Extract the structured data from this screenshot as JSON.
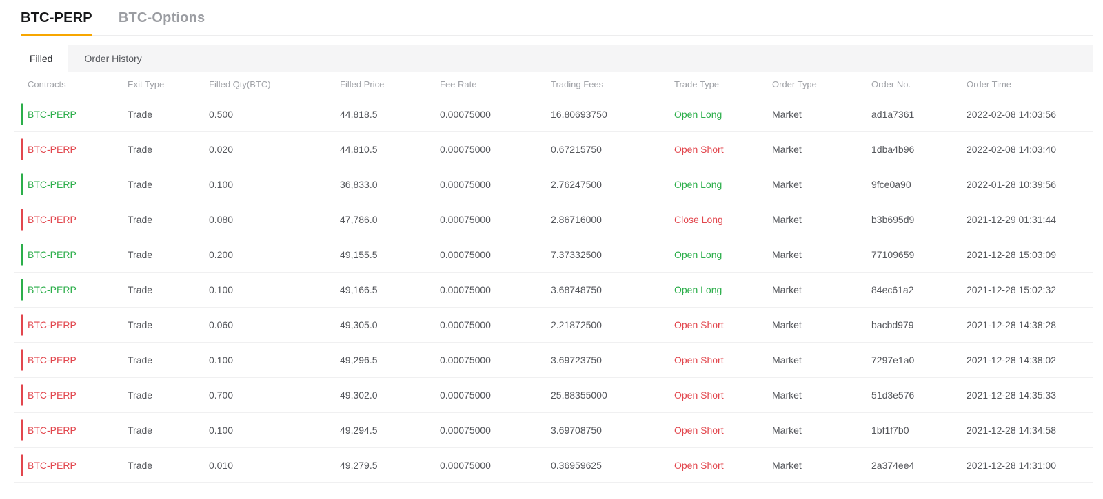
{
  "market_tabs": {
    "items": [
      {
        "label": "BTC-PERP",
        "active": true
      },
      {
        "label": "BTC-Options",
        "active": false
      }
    ]
  },
  "view_tabs": {
    "items": [
      {
        "label": "Filled",
        "active": true
      },
      {
        "label": "Order History",
        "active": false
      }
    ]
  },
  "table": {
    "columns": [
      "Contracts",
      "Exit Type",
      "Filled Qty(BTC)",
      "Filled Price",
      "Fee Rate",
      "Trading Fees",
      "Trade Type",
      "Order Type",
      "Order No.",
      "Order Time"
    ],
    "rows": [
      {
        "color": "green",
        "contracts": "BTC-PERP",
        "exit_type": "Trade",
        "filled_qty": "0.500",
        "filled_price": "44,818.5",
        "fee_rate": "0.00075000",
        "trading_fees": "16.80693750",
        "trade_type": "Open Long",
        "order_type": "Market",
        "order_no": "ad1a7361",
        "order_time": "2022-02-08 14:03:56"
      },
      {
        "color": "red",
        "contracts": "BTC-PERP",
        "exit_type": "Trade",
        "filled_qty": "0.020",
        "filled_price": "44,810.5",
        "fee_rate": "0.00075000",
        "trading_fees": "0.67215750",
        "trade_type": "Open Short",
        "order_type": "Market",
        "order_no": "1dba4b96",
        "order_time": "2022-02-08 14:03:40"
      },
      {
        "color": "green",
        "contracts": "BTC-PERP",
        "exit_type": "Trade",
        "filled_qty": "0.100",
        "filled_price": "36,833.0",
        "fee_rate": "0.00075000",
        "trading_fees": "2.76247500",
        "trade_type": "Open Long",
        "order_type": "Market",
        "order_no": "9fce0a90",
        "order_time": "2022-01-28 10:39:56"
      },
      {
        "color": "red",
        "contracts": "BTC-PERP",
        "exit_type": "Trade",
        "filled_qty": "0.080",
        "filled_price": "47,786.0",
        "fee_rate": "0.00075000",
        "trading_fees": "2.86716000",
        "trade_type": "Close Long",
        "order_type": "Market",
        "order_no": "b3b695d9",
        "order_time": "2021-12-29 01:31:44"
      },
      {
        "color": "green",
        "contracts": "BTC-PERP",
        "exit_type": "Trade",
        "filled_qty": "0.200",
        "filled_price": "49,155.5",
        "fee_rate": "0.00075000",
        "trading_fees": "7.37332500",
        "trade_type": "Open Long",
        "order_type": "Market",
        "order_no": "77109659",
        "order_time": "2021-12-28 15:03:09"
      },
      {
        "color": "green",
        "contracts": "BTC-PERP",
        "exit_type": "Trade",
        "filled_qty": "0.100",
        "filled_price": "49,166.5",
        "fee_rate": "0.00075000",
        "trading_fees": "3.68748750",
        "trade_type": "Open Long",
        "order_type": "Market",
        "order_no": "84ec61a2",
        "order_time": "2021-12-28 15:02:32"
      },
      {
        "color": "red",
        "contracts": "BTC-PERP",
        "exit_type": "Trade",
        "filled_qty": "0.060",
        "filled_price": "49,305.0",
        "fee_rate": "0.00075000",
        "trading_fees": "2.21872500",
        "trade_type": "Open Short",
        "order_type": "Market",
        "order_no": "bacbd979",
        "order_time": "2021-12-28 14:38:28"
      },
      {
        "color": "red",
        "contracts": "BTC-PERP",
        "exit_type": "Trade",
        "filled_qty": "0.100",
        "filled_price": "49,296.5",
        "fee_rate": "0.00075000",
        "trading_fees": "3.69723750",
        "trade_type": "Open Short",
        "order_type": "Market",
        "order_no": "7297e1a0",
        "order_time": "2021-12-28 14:38:02"
      },
      {
        "color": "red",
        "contracts": "BTC-PERP",
        "exit_type": "Trade",
        "filled_qty": "0.700",
        "filled_price": "49,302.0",
        "fee_rate": "0.00075000",
        "trading_fees": "25.88355000",
        "trade_type": "Open Short",
        "order_type": "Market",
        "order_no": "51d3e576",
        "order_time": "2021-12-28 14:35:33"
      },
      {
        "color": "red",
        "contracts": "BTC-PERP",
        "exit_type": "Trade",
        "filled_qty": "0.100",
        "filled_price": "49,294.5",
        "fee_rate": "0.00075000",
        "trading_fees": "3.69708750",
        "trade_type": "Open Short",
        "order_type": "Market",
        "order_no": "1bf1f7b0",
        "order_time": "2021-12-28 14:34:58"
      },
      {
        "color": "red",
        "contracts": "BTC-PERP",
        "exit_type": "Trade",
        "filled_qty": "0.010",
        "filled_price": "49,279.5",
        "fee_rate": "0.00075000",
        "trading_fees": "0.36959625",
        "trade_type": "Open Short",
        "order_type": "Market",
        "order_no": "2a374ee4",
        "order_time": "2021-12-28 14:31:00"
      }
    ]
  },
  "colors": {
    "accent_orange": "#f7a600",
    "long_green": "#2bae4a",
    "short_red": "#e2464d"
  }
}
